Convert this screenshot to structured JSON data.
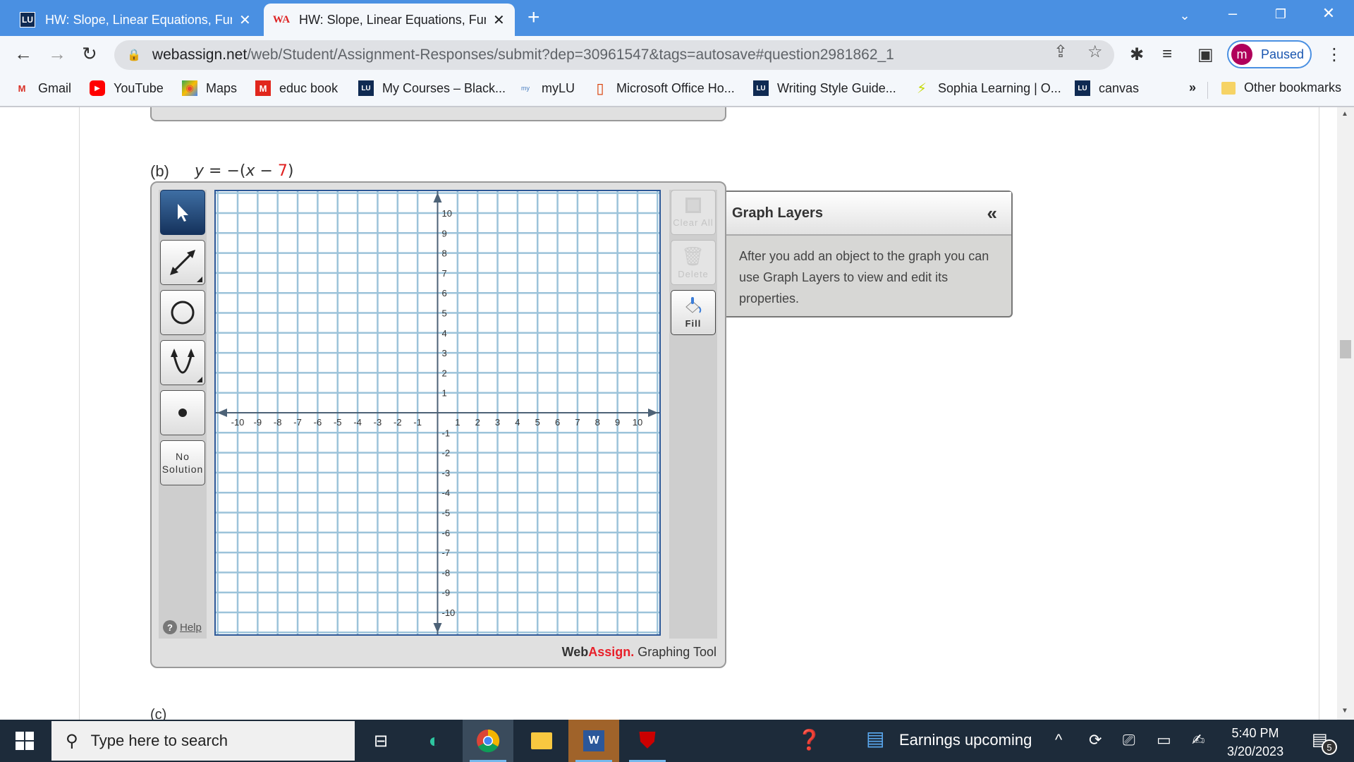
{
  "browser": {
    "tabs": [
      {
        "title": "HW: Slope, Linear Equations, Functions",
        "favicon": "lu-icon",
        "active": false
      },
      {
        "title": "HW: Slope, Linear Equations, Functions",
        "favicon": "webassign-icon",
        "active": true
      }
    ],
    "url_host": "webassign.net",
    "url_path": "/web/Student/Assignment-Responses/submit?dep=30961547&tags=autosave#question2981862_1",
    "profile_initial": "m",
    "profile_status": "Paused",
    "bookmarks": [
      {
        "label": "Gmail",
        "icon": "gmail-icon"
      },
      {
        "label": "YouTube",
        "icon": "youtube-icon"
      },
      {
        "label": "Maps",
        "icon": "maps-icon"
      },
      {
        "label": "educ book",
        "icon": "mcgraw-hill-icon"
      },
      {
        "label": "My Courses – Black...",
        "icon": "lu-icon"
      },
      {
        "label": "myLU",
        "icon": "mylu-icon"
      },
      {
        "label": "Microsoft Office Ho...",
        "icon": "office-icon"
      },
      {
        "label": "Writing Style Guide...",
        "icon": "lu-icon"
      },
      {
        "label": "Sophia Learning | O...",
        "icon": "sophia-icon"
      },
      {
        "label": "canvas",
        "icon": "lu-icon"
      }
    ],
    "bookmarks_overflow": "»",
    "other_bookmarks": "Other bookmarks"
  },
  "question": {
    "part_label": "(b)",
    "equation": {
      "lhs": "y",
      "eq": " = −(",
      "var": "x",
      "minus": " − ",
      "const": "7",
      "close": ")"
    },
    "next_part_hint": "(c)"
  },
  "graph_tool": {
    "tools": [
      {
        "name": "select-tool",
        "selected": true
      },
      {
        "name": "line-tool",
        "selected": false
      },
      {
        "name": "circle-tool",
        "selected": false
      },
      {
        "name": "parabola-tool",
        "selected": false
      },
      {
        "name": "point-tool",
        "selected": false
      },
      {
        "name": "no-solution-tool",
        "label": "No\nSolution",
        "selected": false
      }
    ],
    "no_solution_line1": "No",
    "no_solution_line2": "Solution",
    "help_label": "Help",
    "actions": {
      "clear_all": "Clear All",
      "delete": "Delete",
      "fill": "Fill"
    },
    "brand_web": "Web",
    "brand_assign": "Assign.",
    "brand_suffix": " Graphing Tool",
    "axes": {
      "x_min": -10,
      "x_max": 10,
      "y_min": -10,
      "y_max": 10,
      "x_ticks": [
        -10,
        -9,
        -8,
        -7,
        -6,
        -5,
        -4,
        -3,
        -2,
        -1,
        1,
        2,
        3,
        4,
        5,
        6,
        7,
        8,
        9,
        10
      ],
      "y_ticks": [
        10,
        9,
        8,
        7,
        6,
        5,
        4,
        3,
        2,
        1,
        -1,
        -2,
        -3,
        -4,
        -5,
        -6,
        -7,
        -8,
        -9,
        -10
      ],
      "minor_per_unit": 1
    },
    "colors": {
      "grid": "#9cc3da",
      "axis": "#4d6277",
      "frame": "#2b5797",
      "selected_tool": "#1e426f",
      "brand_red": "#e8202a"
    }
  },
  "graph_layers": {
    "title": "Graph Layers",
    "collapse_label": "«",
    "body": "After you add an object to the graph you can use Graph Layers to view and edit its properties."
  },
  "taskbar": {
    "search_placeholder": "Type here to search",
    "apps": [
      "task-view-icon",
      "edge-icon",
      "chrome-icon",
      "file-explorer-icon",
      "word-icon",
      "mcafee-icon"
    ],
    "news_label": "Earnings upcoming",
    "time": "5:40 PM",
    "date": "3/20/2023",
    "notification_count": "5"
  }
}
